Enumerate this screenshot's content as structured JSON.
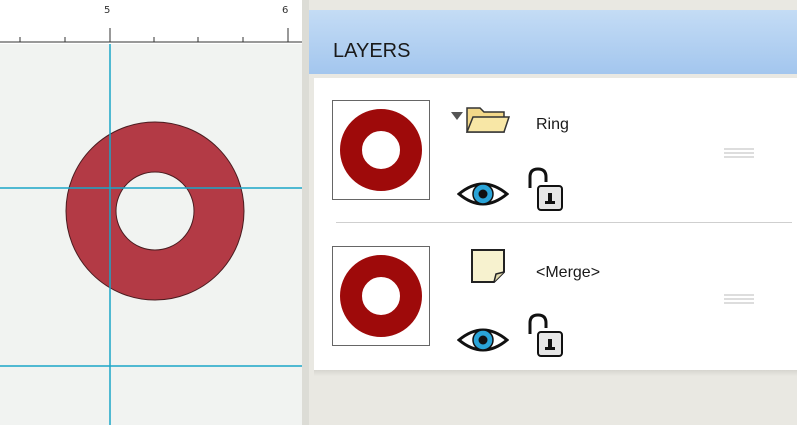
{
  "ruler": {
    "labels": [
      "5",
      "6"
    ]
  },
  "canvas": {
    "shape_color": "#b33a45",
    "guide_color": "#1aa6c8"
  },
  "layers_panel": {
    "title": "LAYERS",
    "header_color": "#a9cbf0",
    "layers": [
      {
        "name": "Ring",
        "icon": "folder-icon",
        "expanded": true,
        "visible": true,
        "locked": false,
        "thumb_color": "#9e0a0a"
      },
      {
        "name": "<Merge>",
        "icon": "note-icon",
        "visible": true,
        "locked": false,
        "thumb_color": "#9e0a0a"
      }
    ]
  }
}
